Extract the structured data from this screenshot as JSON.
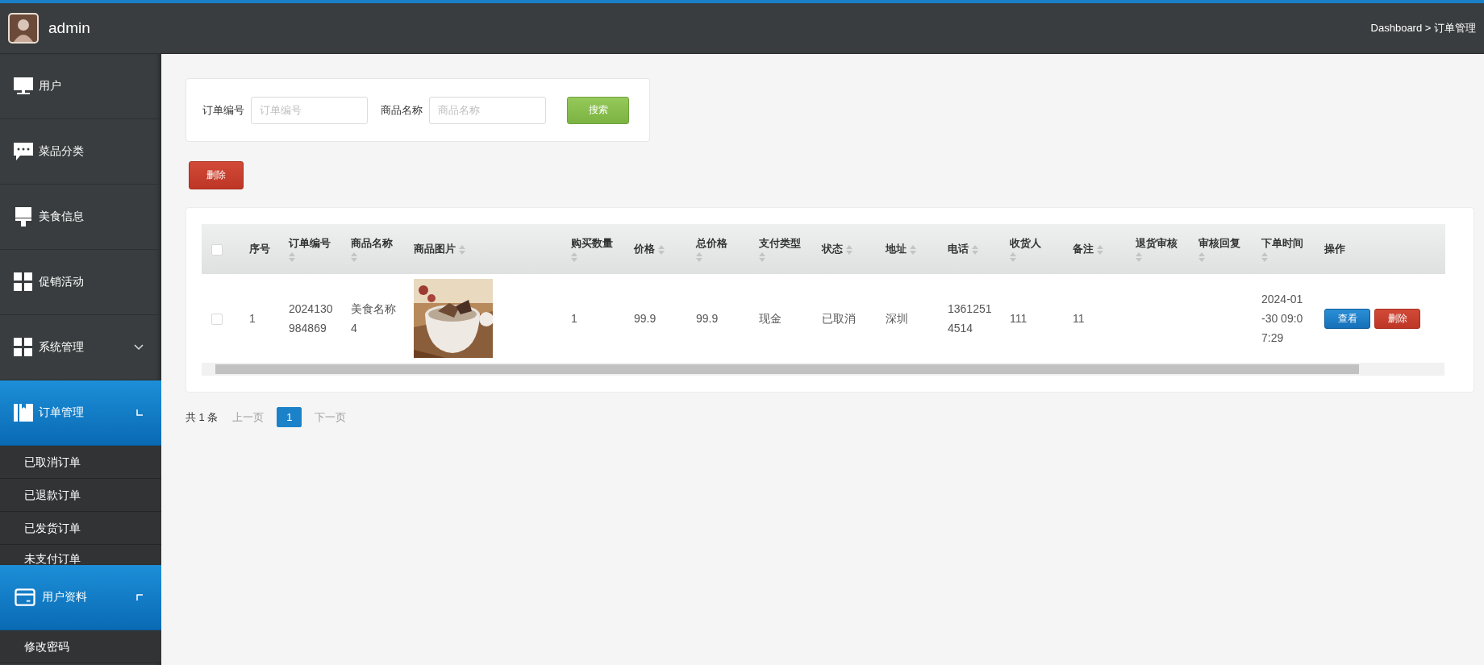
{
  "header": {
    "user": "admin",
    "breadcrumb": "Dashboard > 订单管理"
  },
  "sidebar": {
    "items": [
      {
        "label": "用户",
        "selected": false
      },
      {
        "label": "菜品分类",
        "selected": false
      },
      {
        "label": "美食信息",
        "selected": false
      },
      {
        "label": "促销活动",
        "selected": false
      },
      {
        "label": "系统管理",
        "selected": false,
        "expanded": false
      },
      {
        "label": "订单管理",
        "selected": true,
        "expanded": true,
        "children": [
          {
            "label": "已取消订单"
          },
          {
            "label": "已退款订单"
          },
          {
            "label": "已发货订单"
          },
          {
            "label": "未支付订单"
          }
        ]
      },
      {
        "label": "用户资料",
        "selected": true,
        "expanded": true,
        "children": [
          {
            "label": "修改密码"
          }
        ]
      }
    ]
  },
  "search": {
    "fields": [
      {
        "label": "订单编号",
        "placeholder": "订单编号"
      },
      {
        "label": "商品名称",
        "placeholder": "商品名称"
      }
    ],
    "button": "搜索"
  },
  "delete_button": "删除",
  "table": {
    "select_all_checked": false,
    "columns": [
      {
        "label": "序号",
        "sortable": false
      },
      {
        "label": "订单编号",
        "sortable": true
      },
      {
        "label": "商品名称",
        "sortable": true
      },
      {
        "label": "商品图片",
        "sortable": true
      },
      {
        "label": "购买数量",
        "sortable": true
      },
      {
        "label": "价格",
        "sortable": true
      },
      {
        "label": "总价格",
        "sortable": true
      },
      {
        "label": "支付类型",
        "sortable": true
      },
      {
        "label": "状态",
        "sortable": true
      },
      {
        "label": "地址",
        "sortable": true
      },
      {
        "label": "电话",
        "sortable": true
      },
      {
        "label": "收货人",
        "sortable": true
      },
      {
        "label": "备注",
        "sortable": true
      },
      {
        "label": "退货审核",
        "sortable": true
      },
      {
        "label": "审核回复",
        "sortable": true
      },
      {
        "label": "下单时间",
        "sortable": true
      },
      {
        "label": "操作",
        "sortable": false
      }
    ],
    "rows": [
      {
        "checked": false,
        "cells": [
          {
            "kind": "text",
            "text": "1"
          },
          {
            "kind": "text",
            "text": "2024130984869"
          },
          {
            "kind": "text",
            "text": "美食名称4"
          },
          {
            "kind": "picture"
          },
          {
            "kind": "text",
            "text": "1"
          },
          {
            "kind": "text",
            "text": "99.9"
          },
          {
            "kind": "text",
            "text": "99.9"
          },
          {
            "kind": "text",
            "text": "现金"
          },
          {
            "kind": "text",
            "text": "已取消"
          },
          {
            "kind": "text",
            "text": "深圳"
          },
          {
            "kind": "text",
            "text": "13612514514"
          },
          {
            "kind": "text",
            "text": "111"
          },
          {
            "kind": "text",
            "text": "11"
          },
          {
            "kind": "empty"
          },
          {
            "kind": "empty"
          },
          {
            "kind": "text",
            "text": "2024-01-30 09:07:29"
          },
          {
            "kind": "actions",
            "actions": [
              {
                "kind": "view",
                "label": "查看"
              },
              {
                "kind": "delete",
                "label": "删除"
              }
            ]
          }
        ]
      }
    ]
  },
  "pagination": {
    "total": "共 1 条",
    "prev": {
      "label": "上一页",
      "disabled": true
    },
    "pages": [
      {
        "label": "1",
        "selected": true
      }
    ],
    "next": {
      "label": "下一页",
      "disabled": true
    }
  }
}
